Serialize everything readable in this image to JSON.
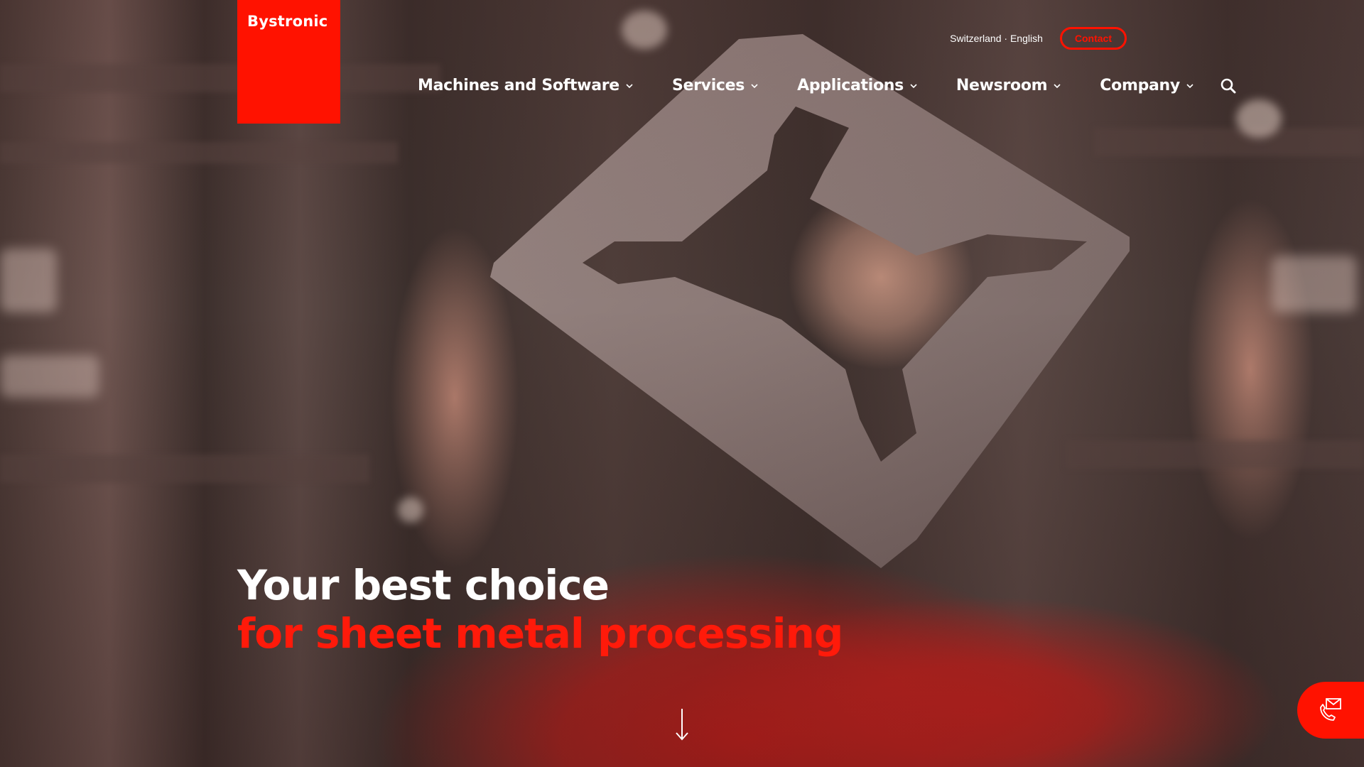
{
  "brand": {
    "name": "Bystronic",
    "accent_color": "#ff1200"
  },
  "utility": {
    "locale": "Switzerland · English",
    "contact_label": "Contact"
  },
  "nav": {
    "items": [
      {
        "label": "Machines and Software",
        "icon": "chevron-down-icon"
      },
      {
        "label": "Services",
        "icon": "chevron-down-icon"
      },
      {
        "label": "Applications",
        "icon": "chevron-down-icon"
      },
      {
        "label": "Newsroom",
        "icon": "chevron-down-icon"
      },
      {
        "label": "Company",
        "icon": "chevron-down-icon"
      }
    ],
    "search_icon": "search-icon"
  },
  "hero": {
    "headline_line1": "Your best choice",
    "headline_line2": "for sheet metal processing",
    "scroll_icon": "arrow-down-icon",
    "image_alt": "Person holding a laser-cut sheet metal part"
  },
  "floating": {
    "contact_icon": "phone-mail-icon"
  }
}
